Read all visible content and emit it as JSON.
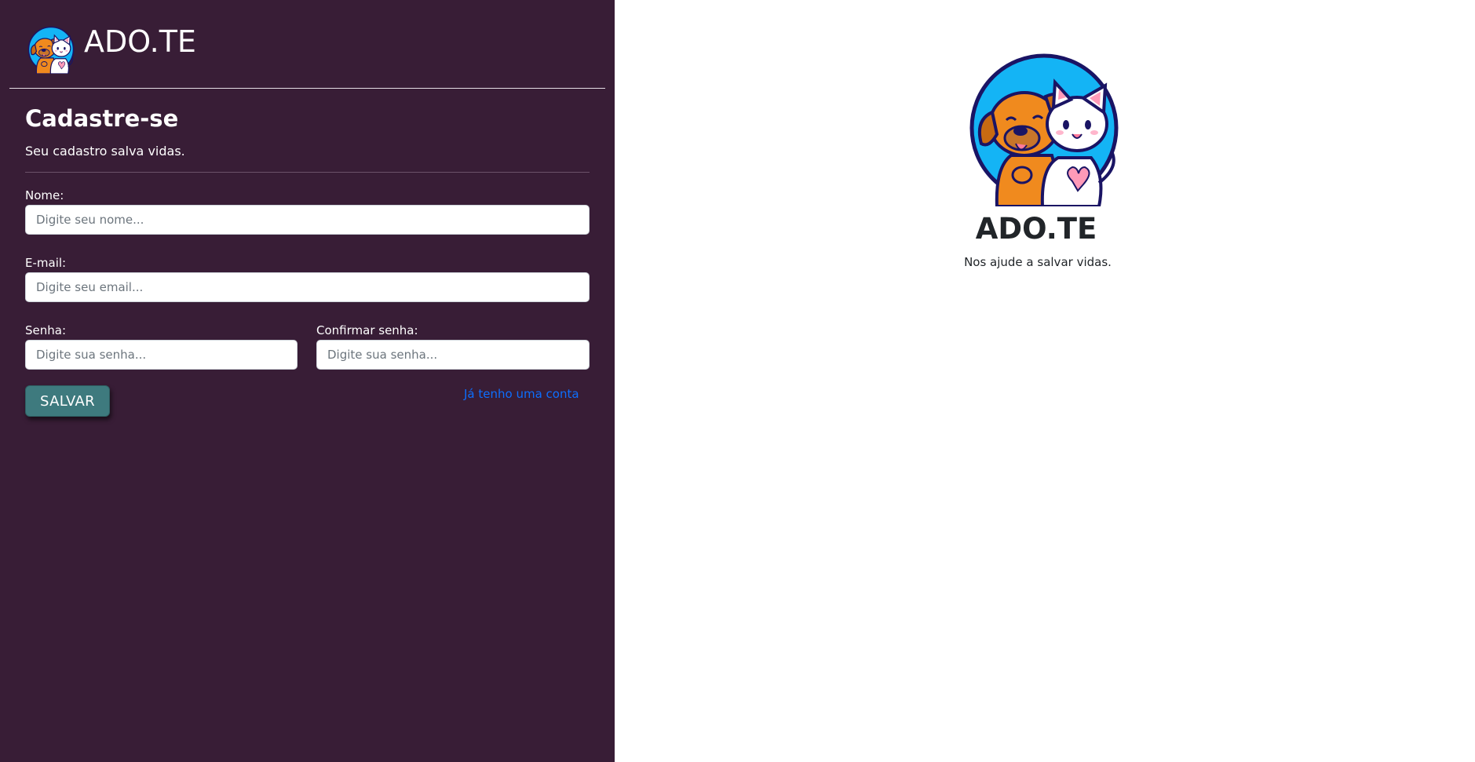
{
  "app": {
    "brand_name": "ADO.TE",
    "logo_icon": "dog-and-cat-logo-icon"
  },
  "form": {
    "title": "Cadastre-se",
    "subtitle": "Seu cadastro salva vidas.",
    "fields": {
      "name": {
        "label": "Nome:",
        "placeholder": "Digite seu nome...",
        "value": ""
      },
      "email": {
        "label": "E-mail:",
        "placeholder": "Digite seu email...",
        "value": ""
      },
      "password": {
        "label": "Senha:",
        "placeholder": "Digite sua senha...",
        "value": ""
      },
      "confirm_password": {
        "label": "Confirmar senha:",
        "placeholder": "Digite sua senha...",
        "value": ""
      }
    },
    "save_label": "SALVAR",
    "login_link": "Já tenho uma conta"
  },
  "hero": {
    "title": "ADO.TE",
    "subtitle": "Nos ajude a salvar vidas."
  },
  "colors": {
    "sidebar_background": "#381d36",
    "button_background": "#3e7a7e",
    "link": "#0d6efd",
    "logo_circle": "#14b4f5",
    "dog": "#f08a1e",
    "cat": "#ffffff",
    "outline": "#1a1464"
  }
}
